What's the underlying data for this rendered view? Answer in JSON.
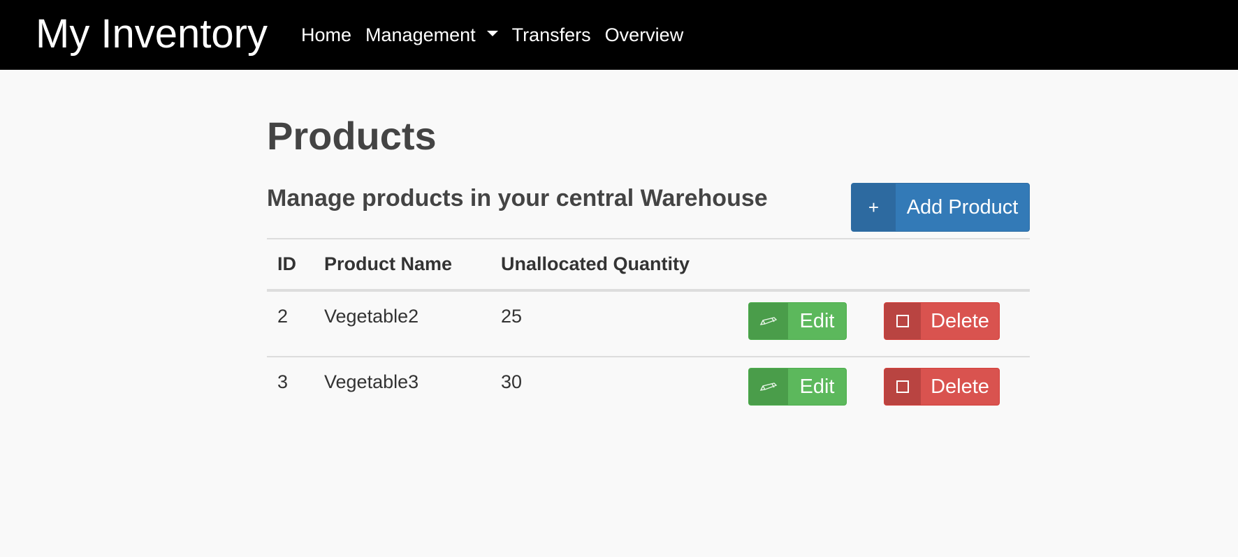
{
  "navbar": {
    "brand": "My Inventory",
    "links": [
      {
        "label": "Home"
      },
      {
        "label": "Management",
        "has_dropdown": true
      },
      {
        "label": "Transfers"
      },
      {
        "label": "Overview"
      }
    ]
  },
  "main": {
    "title": "Products",
    "subtitle": "Manage products in your central Warehouse",
    "add_button": {
      "icon": "+",
      "label": "Add Product"
    }
  },
  "table": {
    "columns": [
      "ID",
      "Product Name",
      "Unallocated Quantity"
    ],
    "rows": [
      {
        "id": "2",
        "name": "Vegetable2",
        "quantity": "25",
        "edit_label": "Edit",
        "delete_label": "Delete"
      },
      {
        "id": "3",
        "name": "Vegetable3",
        "quantity": "30",
        "edit_label": "Edit",
        "delete_label": "Delete"
      }
    ]
  },
  "icons": {
    "add": "plus-icon",
    "edit": "pencil-icon",
    "delete": "square-icon"
  },
  "colors": {
    "navbar_bg": "#000000",
    "primary": "#337ab7",
    "success": "#5cb85c",
    "danger": "#d9534f",
    "page_bg": "#f9f9f9"
  }
}
